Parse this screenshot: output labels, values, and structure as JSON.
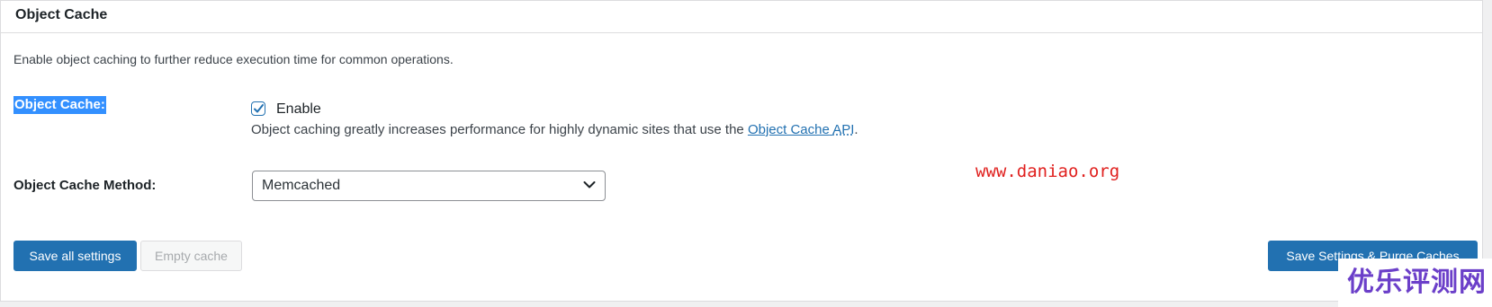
{
  "panel": {
    "title": "Object Cache",
    "description": "Enable object caching to further reduce execution time for common operations."
  },
  "object_cache": {
    "label": "Object Cache:",
    "checkbox_checked": true,
    "checkbox_label": "Enable",
    "help_prefix": "Object caching greatly increases performance for highly dynamic sites that use the ",
    "help_link": "Object Cache",
    "help_link_api": "API",
    "help_suffix": ".",
    "icon": "checkmark-icon"
  },
  "cache_method": {
    "label": "Object Cache Method:",
    "selected": "Memcached",
    "icon": "chevron-down-icon"
  },
  "buttons": {
    "save_all": "Save all settings",
    "empty_cache": "Empty cache",
    "save_purge": "Save Settings & Purge Caches"
  },
  "watermarks": {
    "url": "www.daniao.org",
    "logo": "优乐评测网"
  },
  "colors": {
    "primary": "#2271b1",
    "selection": "#3390ff",
    "watermark_red": "#e0201e",
    "watermark_purple": "#6b3fc9"
  }
}
